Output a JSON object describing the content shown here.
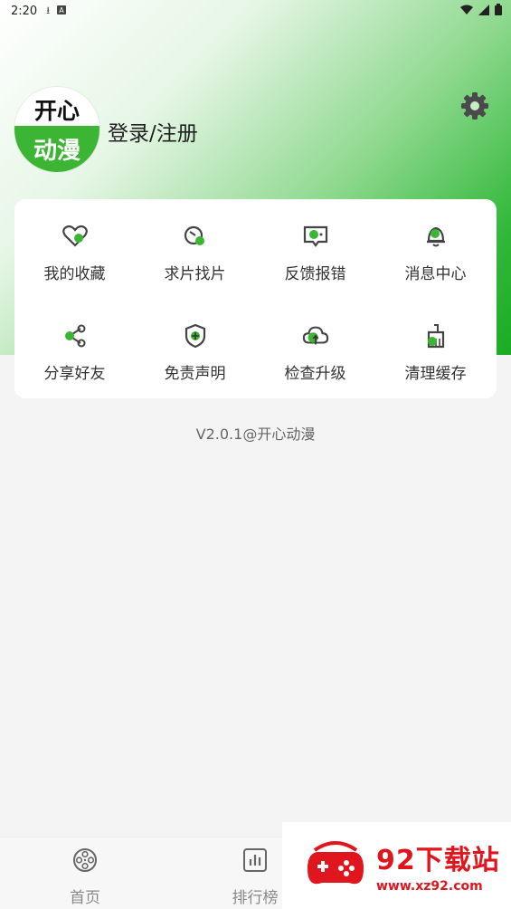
{
  "status_bar": {
    "time": "2:20"
  },
  "profile": {
    "logo_line1": "开心",
    "logo_line2": "动漫",
    "login_label": "登录/注册"
  },
  "colors": {
    "accent": "#3cb534",
    "watermark": "#e0161e"
  },
  "menu": [
    {
      "label": "我的收藏",
      "icon": "heart-icon"
    },
    {
      "label": "求片找片",
      "icon": "search-film-icon"
    },
    {
      "label": "反馈报错",
      "icon": "feedback-icon"
    },
    {
      "label": "消息中心",
      "icon": "bell-icon"
    },
    {
      "label": "分享好友",
      "icon": "share-icon"
    },
    {
      "label": "免责声明",
      "icon": "shield-icon"
    },
    {
      "label": "检查升级",
      "icon": "cloud-upload-icon"
    },
    {
      "label": "清理缓存",
      "icon": "broom-icon"
    }
  ],
  "version": "V2.0.1@开心动漫",
  "bottom_nav": [
    {
      "label": "首页",
      "icon": "film-reel-icon"
    },
    {
      "label": "排行榜",
      "icon": "chart-icon"
    }
  ],
  "watermark": {
    "title": "92下载站",
    "url": "www.xz92.com"
  }
}
